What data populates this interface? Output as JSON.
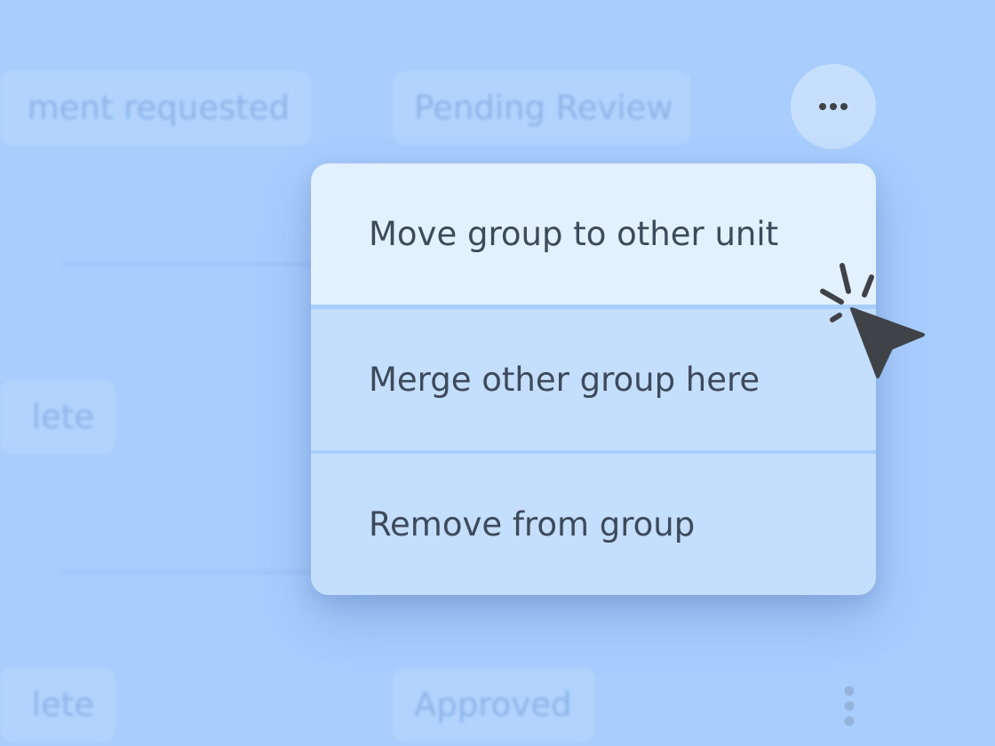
{
  "background_rows": [
    {
      "status": "ment requested",
      "review": "Pending Review"
    },
    {
      "status": "lete"
    },
    {
      "status": "lete",
      "review": "Approved"
    }
  ],
  "menu": {
    "items": [
      {
        "label": "Move group to other unit",
        "state": "hovered"
      },
      {
        "label": "Merge other group here",
        "state": "default"
      },
      {
        "label": "Remove from group",
        "state": "default"
      }
    ]
  },
  "icons": {
    "more_button": "more-horizontal-icon",
    "row_menu": "more-vertical-icon",
    "pointer": "cursor-click-icon"
  },
  "colors": {
    "background": "#a9cdfd",
    "menu_item": "#c4defd",
    "menu_item_hover": "#e3f0fe",
    "menu_text": "#3d4a5a",
    "faded_text": "#8fb3e8",
    "cursor": "#3f4347"
  }
}
